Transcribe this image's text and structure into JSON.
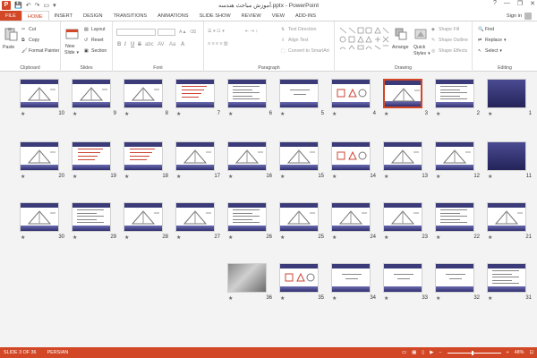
{
  "titlebar": {
    "app_icon": "P",
    "title": "آموزش مباحث هندسه.pptx - PowerPoint",
    "qat_icons": [
      "save-icon",
      "undo-icon",
      "redo-icon",
      "present-icon",
      "customize-icon"
    ],
    "help": "?",
    "minimize": "—",
    "restore": "❐",
    "close": "✕"
  },
  "tabs": [
    {
      "label": "FILE"
    },
    {
      "label": "HOME"
    },
    {
      "label": "INSERT"
    },
    {
      "label": "DESIGN"
    },
    {
      "label": "TRANSITIONS"
    },
    {
      "label": "ANIMATIONS"
    },
    {
      "label": "SLIDE SHOW"
    },
    {
      "label": "REVIEW"
    },
    {
      "label": "VIEW"
    },
    {
      "label": "ADD-INS"
    }
  ],
  "account": {
    "signin": "Sign in"
  },
  "ribbon": {
    "clipboard": {
      "label": "Clipboard",
      "paste": "Paste",
      "cut": "Cut",
      "copy": "Copy",
      "format_painter": "Format Painter"
    },
    "slides": {
      "label": "Slides",
      "new_slide": "New",
      "new_slide2": "Slide",
      "layout": "Layout",
      "reset": "Reset",
      "section": "Section"
    },
    "font": {
      "label": "Font",
      "bold": "B",
      "italic": "I",
      "underline": "U",
      "strike": "S",
      "shadow": "abc",
      "spacing": "AV",
      "case": "Aa",
      "color": "A"
    },
    "paragraph": {
      "label": "Paragraph",
      "text_direction": "Text Direction",
      "align_text": "Align Text",
      "convert_smartart": "Convert to SmartArt"
    },
    "drawing": {
      "label": "Drawing",
      "arrange": "Arrange",
      "quick_styles": "Quick",
      "quick_styles2": "Styles",
      "shape_fill": "Shape Fill",
      "shape_outline": "Shape Outline",
      "shape_effects": "Shape Effects"
    },
    "editing": {
      "label": "Editing",
      "find": "Find",
      "replace": "Replace",
      "select": "Select"
    }
  },
  "slides": {
    "total": 36,
    "selected": 3,
    "items": [
      {
        "n": "1",
        "kind": "full"
      },
      {
        "n": "2",
        "kind": "table"
      },
      {
        "n": "3",
        "kind": "selected"
      },
      {
        "n": "4",
        "kind": "shapes"
      },
      {
        "n": "5",
        "kind": "title"
      },
      {
        "n": "6",
        "kind": "text"
      },
      {
        "n": "7",
        "kind": "redtext"
      },
      {
        "n": "8",
        "kind": "diagram"
      },
      {
        "n": "9",
        "kind": "diagram"
      },
      {
        "n": "10",
        "kind": "diagram"
      },
      {
        "n": "11",
        "kind": "full"
      },
      {
        "n": "12",
        "kind": "diagram"
      },
      {
        "n": "13",
        "kind": "diagram"
      },
      {
        "n": "14",
        "kind": "shapes"
      },
      {
        "n": "15",
        "kind": "diagram"
      },
      {
        "n": "16",
        "kind": "diagram"
      },
      {
        "n": "17",
        "kind": "diagram"
      },
      {
        "n": "18",
        "kind": "redtext"
      },
      {
        "n": "19",
        "kind": "redtext"
      },
      {
        "n": "20",
        "kind": "diagram"
      },
      {
        "n": "21",
        "kind": "diagram"
      },
      {
        "n": "22",
        "kind": "text"
      },
      {
        "n": "23",
        "kind": "diagram"
      },
      {
        "n": "24",
        "kind": "diagram"
      },
      {
        "n": "25",
        "kind": "diagram"
      },
      {
        "n": "26",
        "kind": "text"
      },
      {
        "n": "27",
        "kind": "diagram"
      },
      {
        "n": "28",
        "kind": "diagram"
      },
      {
        "n": "29",
        "kind": "text"
      },
      {
        "n": "30",
        "kind": "diagram"
      },
      {
        "n": "31",
        "kind": "text"
      },
      {
        "n": "32",
        "kind": "plain"
      },
      {
        "n": "33",
        "kind": "plain"
      },
      {
        "n": "34",
        "kind": "plain"
      },
      {
        "n": "35",
        "kind": "shapes"
      },
      {
        "n": "36",
        "kind": "photo"
      }
    ],
    "star": "★"
  },
  "status": {
    "slide_of": "SLIDE 3 OF 36",
    "language": "PERSIAN",
    "zoom": "48%",
    "zoom_fraction": 0.48,
    "zoom_out": "−",
    "zoom_in": "+"
  },
  "colors": {
    "accent": "#d24726",
    "slide_band": "#3b3b7a"
  }
}
